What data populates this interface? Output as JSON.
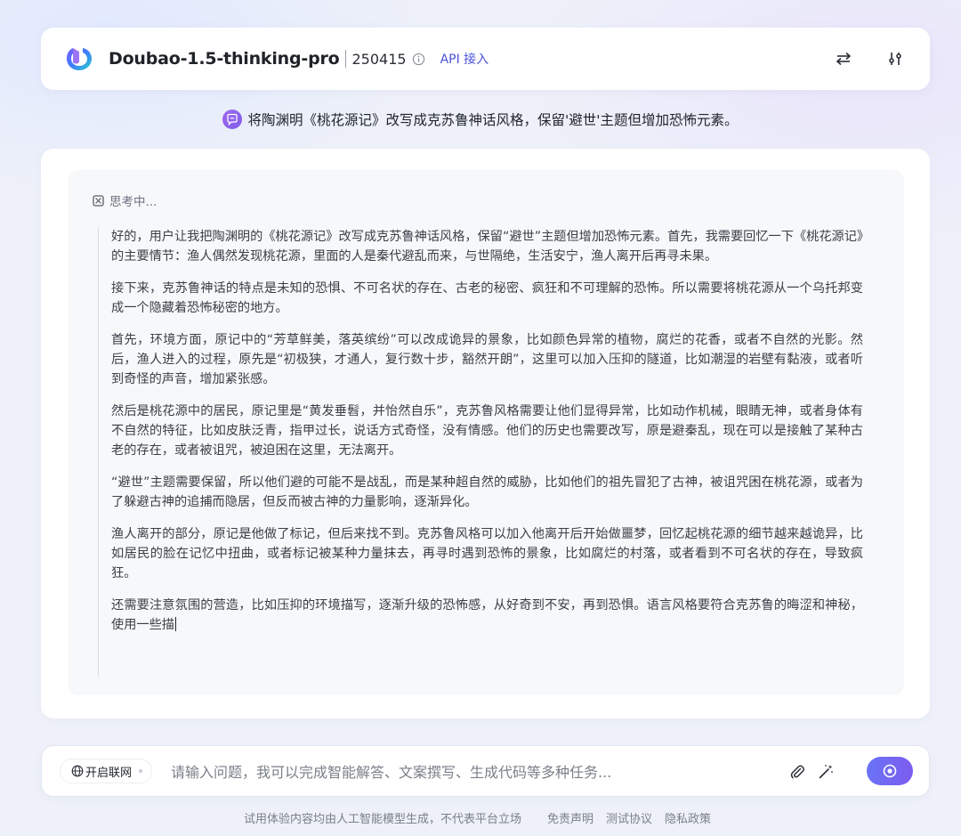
{
  "header": {
    "model_name": "Doubao-1.5-thinking-pro",
    "version": "250415",
    "api_label": "API 接入",
    "icons": [
      "doubao-logo",
      "info-icon",
      "switch-arrows-icon",
      "settings-sliders-icon"
    ]
  },
  "prompt": {
    "text": "将陶渊明《桃花源记》改写成克苏鲁神话风格，保留'避世'主题但增加恐怖元素。"
  },
  "thinking": {
    "status": "思考中...",
    "paragraphs": [
      "好的，用户让我把陶渊明的《桃花源记》改写成克苏鲁神话风格，保留“避世”主题但增加恐怖元素。首先，我需要回忆一下《桃花源记》的主要情节：渔人偶然发现桃花源，里面的人是秦代避乱而来，与世隔绝，生活安宁，渔人离开后再寻未果。",
      "接下来，克苏鲁神话的特点是未知的恐惧、不可名状的存在、古老的秘密、疯狂和不可理解的恐怖。所以需要将桃花源从一个乌托邦变成一个隐藏着恐怖秘密的地方。",
      "首先，环境方面，原记中的“芳草鲜美，落英缤纷”可以改成诡异的景象，比如颜色异常的植物，腐烂的花香，或者不自然的光影。然后，渔人进入的过程，原先是“初极狭，才通人，复行数十步，豁然开朗”，这里可以加入压抑的隧道，比如潮湿的岩壁有黏液，或者听到奇怪的声音，增加紧张感。",
      "然后是桃花源中的居民，原记里是“黄发垂髫，并怡然自乐”，克苏鲁风格需要让他们显得异常，比如动作机械，眼睛无神，或者身体有不自然的特征，比如皮肤泛青，指甲过长，说话方式奇怪，没有情感。他们的历史也需要改写，原是避秦乱，现在可以是接触了某种古老的存在，或者被诅咒，被迫困在这里，无法离开。",
      "“避世”主题需要保留，所以他们避的可能不是战乱，而是某种超自然的威胁，比如他们的祖先冒犯了古神，被诅咒困在桃花源，或者为了躲避古神的追捕而隐居，但反而被古神的力量影响，逐渐异化。",
      "渔人离开的部分，原记是他做了标记，但后来找不到。克苏鲁风格可以加入他离开后开始做噩梦，回忆起桃花源的细节越来越诡异，比如居民的脸在记忆中扭曲，或者标记被某种力量抹去，再寻时遇到恐怖的景象，比如腐烂的村落，或者看到不可名状的存在，导致疯狂。",
      "还需要注意氛围的营造，比如压抑的环境描写，逐渐升级的恐怖感，从好奇到不安，再到恐惧。语言风格要符合克苏鲁的晦涩和神秘，使用一些描"
    ]
  },
  "input": {
    "web_toggle_label": "开启联网",
    "placeholder": "请输入问题，我可以完成智能解答、文案撰写、生成代码等多种任务...",
    "value": "",
    "icons": [
      "globe-icon",
      "paperclip-icon",
      "magic-wand-icon",
      "send-icon"
    ]
  },
  "footer": {
    "disclaimer": "试用体验内容均由人工智能模型生成，不代表平台立场",
    "links": [
      "免责声明",
      "测试协议",
      "隐私政策"
    ]
  },
  "colors": {
    "accent": "#4a52d9",
    "send_gradient_start": "#6a73f5",
    "send_gradient_end": "#7c5cf0",
    "background": "#eef1f9"
  }
}
